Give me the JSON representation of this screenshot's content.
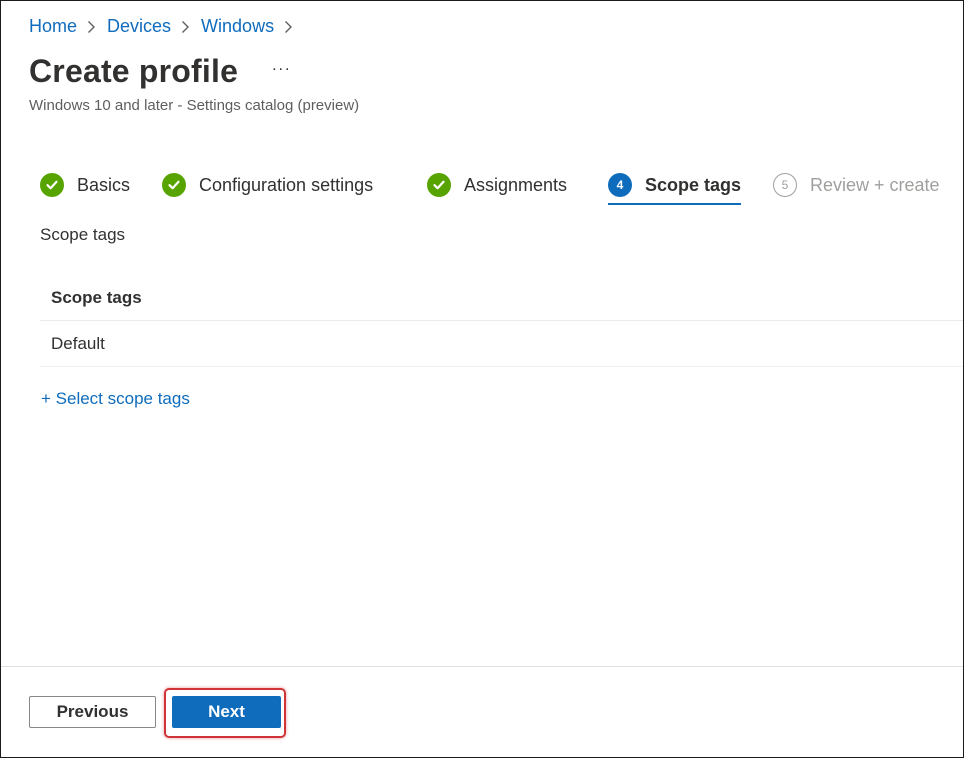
{
  "breadcrumb": {
    "items": [
      "Home",
      "Devices",
      "Windows"
    ]
  },
  "header": {
    "title": "Create profile",
    "more_label": "...",
    "subtitle": "Windows 10 and later - Settings catalog (preview)"
  },
  "steps": [
    {
      "label": "Basics",
      "state": "completed"
    },
    {
      "label": "Configuration settings",
      "state": "completed"
    },
    {
      "label": "Assignments",
      "state": "completed"
    },
    {
      "label": "Scope tags",
      "number": "4",
      "state": "active"
    },
    {
      "label": "Review + create",
      "number": "5",
      "state": "pending"
    }
  ],
  "main": {
    "section_label": "Scope tags",
    "table": {
      "header": "Scope tags",
      "rows": [
        "Default"
      ]
    },
    "select_link": "+ Select scope tags"
  },
  "footer": {
    "previous_label": "Previous",
    "next_label": "Next"
  },
  "colors": {
    "link": "#0f6cbd",
    "success": "#57a300",
    "primary": "#0f6cbd",
    "highlight": "#d13438"
  }
}
